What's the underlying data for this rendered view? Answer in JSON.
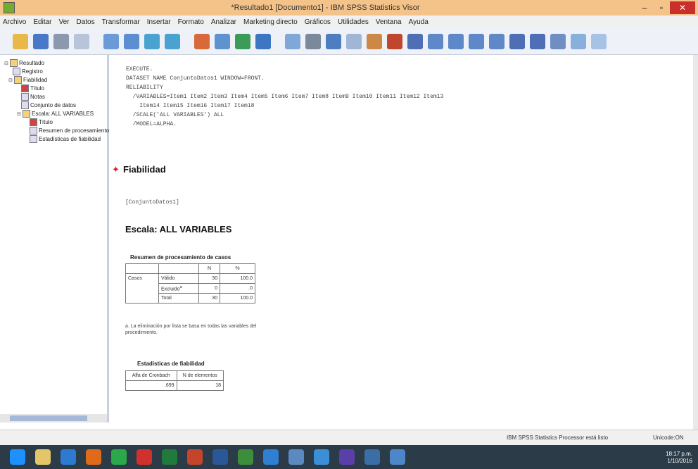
{
  "window": {
    "title": "*Resultado1 [Documento1] - IBM SPSS Statistics Visor"
  },
  "menu": [
    "Archivo",
    "Editar",
    "Ver",
    "Datos",
    "Transformar",
    "Insertar",
    "Formato",
    "Analizar",
    "Marketing directo",
    "Gráficos",
    "Utilidades",
    "Ventana",
    "Ayuda"
  ],
  "tree": {
    "root": "Resultado",
    "log": "Registro",
    "reliability": "Fiabilidad",
    "title": "Título",
    "notes": "Notas",
    "dataset": "Conjunto de datos",
    "scale": "Escala: ALL VARIABLES",
    "scale_title": "Título",
    "summary": "Resumen de procesamiento de casos",
    "stats": "Estadísticas de fiabilidad"
  },
  "syntax": [
    "EXECUTE.",
    "DATASET NAME ConjuntoDatos1 WINDOW=FRONT.",
    "RELIABILITY",
    "  /VARIABLES=Item1 Item2 Item3 Item4 Item5 Item6 Item7 Item8 Item9 Item10 Item11 Item12 Item13",
    "    Item14 Item15 Item16 Item17 Item18",
    "  /SCALE('ALL VARIABLES') ALL",
    "  /MODEL=ALPHA."
  ],
  "heading": "Fiabilidad",
  "dataset_tag": "[ConjuntoDatos1]",
  "scale_heading": "Escala: ALL VARIABLES",
  "summary_table": {
    "caption": "Resumen de procesamiento de casos",
    "col_n": "N",
    "col_pct": "%",
    "group": "Casos",
    "rows": [
      {
        "label": "Válido",
        "n": "30",
        "pct": "100.0"
      },
      {
        "label": "Excluido",
        "sup": "a",
        "n": "0",
        "pct": ".0"
      },
      {
        "label": "Total",
        "n": "30",
        "pct": "100.0"
      }
    ],
    "footnote": "a. La eliminación por lista se basa en todas las variables del procedimiento."
  },
  "reliability_table": {
    "caption": "Estadísticas de fiabilidad",
    "col_alpha": "Alfa de Cronbach",
    "col_n": "N de elementos",
    "alpha": ".699",
    "n_items": "18"
  },
  "status": {
    "processor": "IBM SPSS Statistics Processor está listo",
    "encoding": "Unicode:ON"
  },
  "tray": {
    "time": "18:17 p.m.",
    "date": "1/10/2016"
  }
}
